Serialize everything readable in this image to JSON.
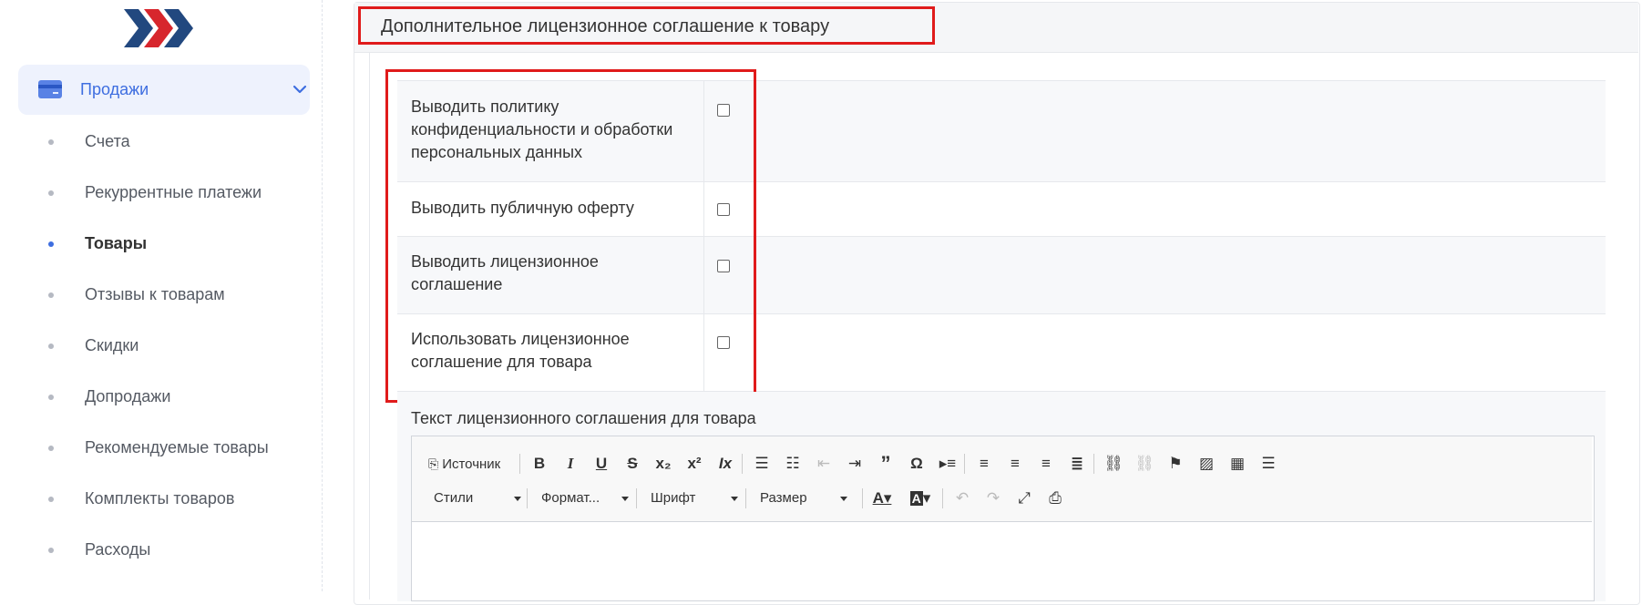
{
  "sidebar": {
    "section_label": "Продажи",
    "items": [
      {
        "label": "Счета",
        "active": false
      },
      {
        "label": "Рекуррентные платежи",
        "active": false
      },
      {
        "label": "Товары",
        "active": true
      },
      {
        "label": "Отзывы к товарам",
        "active": false
      },
      {
        "label": "Скидки",
        "active": false
      },
      {
        "label": "Допродажи",
        "active": false
      },
      {
        "label": "Рекомендуемые товары",
        "active": false
      },
      {
        "label": "Комплекты товаров",
        "active": false
      },
      {
        "label": "Расходы",
        "active": false
      }
    ]
  },
  "panel": {
    "title": "Дополнительное лицензионное соглашение к товару"
  },
  "options": [
    {
      "label": "Выводить политику конфиденциальности и обработки персональных данных",
      "checked": false
    },
    {
      "label": "Выводить публичную оферту",
      "checked": false
    },
    {
      "label": "Выводить лицензионное соглашение",
      "checked": false
    },
    {
      "label": "Использовать лицензионное соглашение для товара",
      "checked": false
    }
  ],
  "editor": {
    "label": "Текст лицензионного соглашения для товара",
    "source_label": "Источник",
    "styles_label": "Стили",
    "format_label": "Формат...",
    "font_label": "Шрифт",
    "size_label": "Размер"
  },
  "colors": {
    "accent": "#3e6ee0",
    "highlight": "#e01b1b"
  }
}
